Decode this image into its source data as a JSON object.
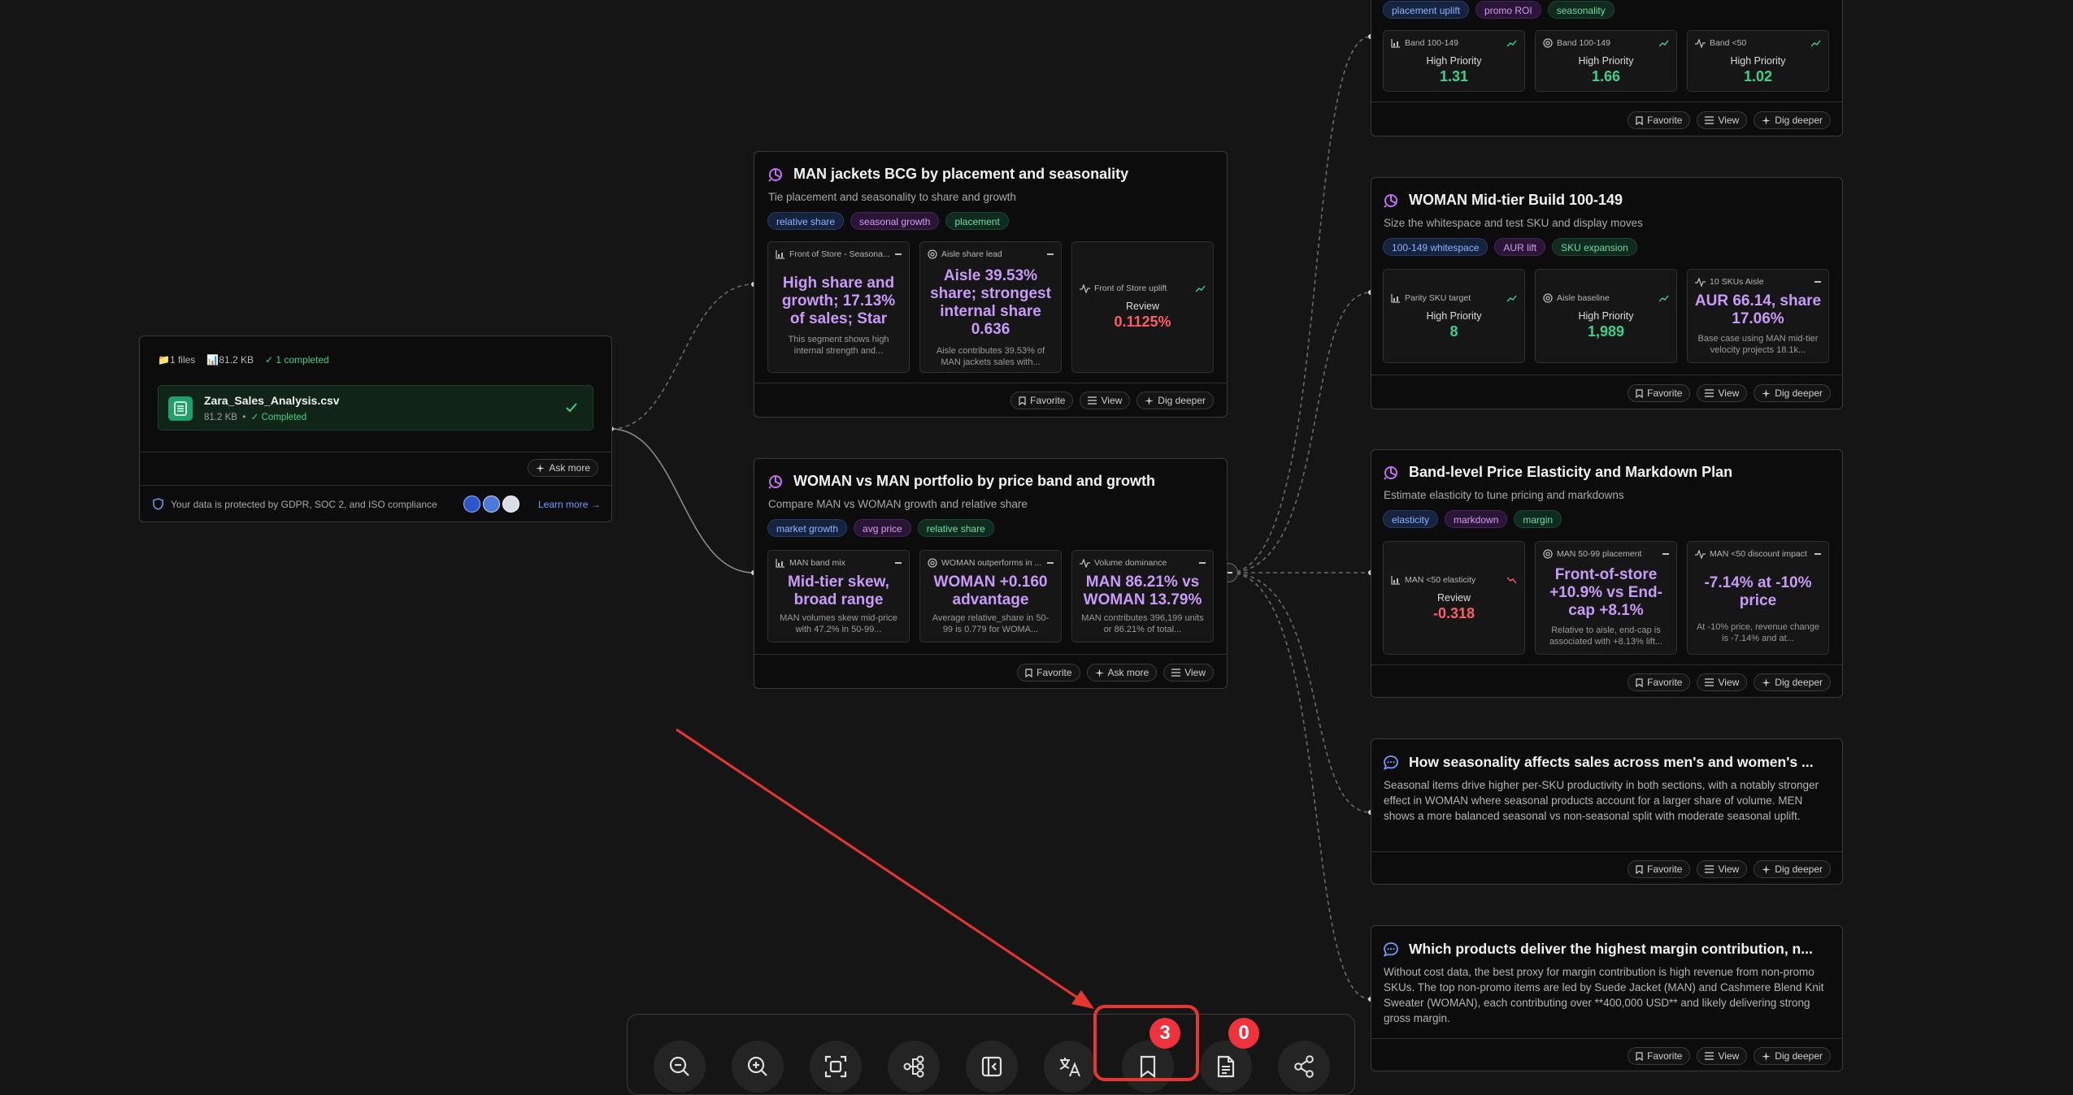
{
  "upload": {
    "files_count": "1 files",
    "total_size": "81.2 KB",
    "completed": "✓ 1 completed",
    "file_name": "Zara_Sales_Analysis.csv",
    "file_size": "81.2 KB",
    "file_status": "✓ Completed",
    "ask_more": "Ask more",
    "privacy_text": "Your data is protected by GDPR, SOC 2, and ISO compliance",
    "learn_more": "Learn more →"
  },
  "buttons": {
    "favorite": "Favorite",
    "view": "View",
    "dig_deeper": "Dig deeper",
    "ask_more": "Ask more"
  },
  "cards": {
    "top_right": {
      "tags": [
        "placement uplift",
        "promo ROI",
        "seasonality"
      ],
      "metrics": [
        {
          "head": "Band 100-149",
          "label": "High Priority",
          "value": "1.31"
        },
        {
          "head": "Band 100-149",
          "label": "High Priority",
          "value": "1.66"
        },
        {
          "head": "Band <50",
          "label": "High Priority",
          "value": "1.02"
        }
      ]
    },
    "jackets": {
      "title": "MAN jackets BCG by placement and seasonality",
      "subtitle": "Tie placement and seasonality to share and growth",
      "tags": [
        "relative share",
        "seasonal growth",
        "placement"
      ],
      "metrics": [
        {
          "head": "Front of Store - Seasona...",
          "big": "High share and growth; 17.13% of sales; Star",
          "small": "This segment shows high internal strength and..."
        },
        {
          "head": "Aisle share lead",
          "big": "Aisle 39.53% share; strongest internal share 0.636",
          "small": "Aisle contributes 39.53% of MAN jackets sales with..."
        },
        {
          "head": "Front of Store uplift",
          "label": "Review",
          "value": "0.1125%"
        }
      ]
    },
    "portfolio": {
      "title": "WOMAN vs MAN portfolio by price band and growth",
      "subtitle": "Compare MAN vs WOMAN growth and relative share",
      "tags": [
        "market growth",
        "avg price",
        "relative share"
      ],
      "metrics": [
        {
          "head": "MAN band mix",
          "big": "Mid-tier skew, broad range",
          "small": "MAN volumes skew mid-price with 47.2% in 50-99..."
        },
        {
          "head": "WOMAN outperforms in ...",
          "big": "WOMAN +0.160 advantage",
          "small": "Average relative_share in 50-99 is 0.779 for WOMA..."
        },
        {
          "head": "Volume dominance",
          "big": "MAN 86.21% vs WOMAN 13.79%",
          "small": "MAN contributes 396,199 units or 86.21% of total..."
        }
      ]
    },
    "midtier": {
      "title": "WOMAN Mid-tier Build 100-149",
      "subtitle": "Size the whitespace and test SKU and display moves",
      "tags": [
        "100-149 whitespace",
        "AUR lift",
        "SKU expansion"
      ],
      "metrics": [
        {
          "head": "Parity SKU target",
          "label": "High Priority",
          "value": "8"
        },
        {
          "head": "Aisle baseline",
          "label": "High Priority",
          "value": "1,989"
        },
        {
          "head": "10 SKUs Aisle",
          "big": "AUR 66.14, share 17.06%",
          "small": "Base case using MAN mid-tier velocity projects 18.1k..."
        }
      ]
    },
    "elasticity": {
      "title": "Band-level Price Elasticity and Markdown Plan",
      "subtitle": "Estimate elasticity to tune pricing and markdowns",
      "tags": [
        "elasticity",
        "markdown",
        "margin"
      ],
      "metrics": [
        {
          "head": "MAN <50 elasticity",
          "label": "Review",
          "value": "-0.318"
        },
        {
          "head": "MAN 50-99 placement",
          "big": "Front-of-store +10.9% vs End-cap +8.1%",
          "small": "Relative to aisle, end-cap is associated with +8.13% lift..."
        },
        {
          "head": "MAN <50 discount impact",
          "big": "-7.14% at -10% price",
          "small": "At -10% price, revenue change is -7.14% and at..."
        }
      ]
    },
    "seasonality": {
      "title": "How seasonality affects sales across men's and women's ...",
      "text": "Seasonal items drive higher per-SKU productivity in both sections, with a notably stronger effect in WOMAN where seasonal products account for a larger share of volume. MEN shows a more balanced seasonal vs non-seasonal split with moderate seasonal uplift."
    },
    "margin": {
      "title": "Which products deliver the highest margin contribution, n...",
      "text": "Without cost data, the best proxy for margin contribution is high revenue from non-promo SKUs. The top non-promo items are led by Suede Jacket (MAN) and Cashmere Blend Knit Sweater (WOMAN), each contributing over **400,000 USD** and likely delivering strong gross margin."
    }
  },
  "toolbar": {
    "bookmarks_count": "3",
    "reports_count": "0"
  },
  "colors": {
    "background": "#151515",
    "accent_purple": "#c99af7",
    "accent_green": "#3ed08a",
    "accent_red": "#ff5b67",
    "highlight": "#e8362f"
  },
  "icons": [
    "zoom-out-icon",
    "zoom-in-icon",
    "fit-screen-icon",
    "tree-layout-icon",
    "collapse-panel-icon",
    "translate-icon",
    "bookmark-icon",
    "report-icon",
    "share-icon"
  ]
}
